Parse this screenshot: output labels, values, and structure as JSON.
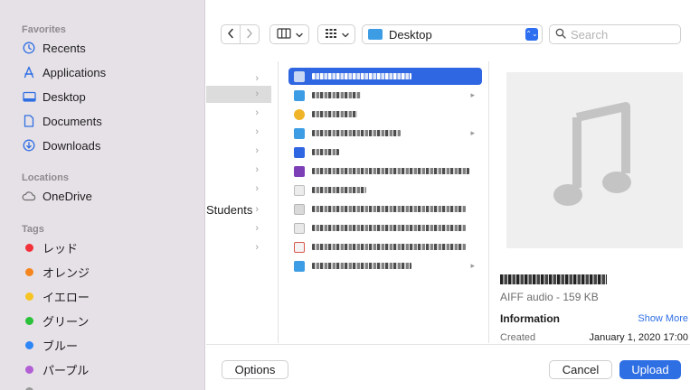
{
  "sidebar": {
    "favorites_title": "Favorites",
    "favorites": [
      {
        "label": "Recents",
        "icon": "clock-icon"
      },
      {
        "label": "Applications",
        "icon": "applications-icon"
      },
      {
        "label": "Desktop",
        "icon": "desktop-icon"
      },
      {
        "label": "Documents",
        "icon": "document-icon"
      },
      {
        "label": "Downloads",
        "icon": "download-icon"
      }
    ],
    "locations_title": "Locations",
    "locations": [
      {
        "label": "OneDrive",
        "icon": "cloud-icon"
      }
    ],
    "tags_title": "Tags",
    "tags": [
      {
        "label": "レッド",
        "color": "#f2313b"
      },
      {
        "label": "オレンジ",
        "color": "#f5861f"
      },
      {
        "label": "イエロー",
        "color": "#f6c423"
      },
      {
        "label": "グリーン",
        "color": "#2bc13a"
      },
      {
        "label": "ブルー",
        "color": "#2f86f6"
      },
      {
        "label": "パープル",
        "color": "#b25fd6"
      }
    ]
  },
  "toolbar": {
    "back_icon": "chevron-left-icon",
    "forward_icon": "chevron-right-icon",
    "view_icon": "columns-view-icon",
    "group_icon": "grid-icon",
    "location_label": "Desktop",
    "search_placeholder": "Search"
  },
  "browser": {
    "parent_column": {
      "visible_label": "Students"
    },
    "files": [
      {
        "icon_color": "#c9d6f4",
        "selected": true
      },
      {
        "icon_color": "#3d9de4",
        "selected": false
      },
      {
        "icon_color": "#f0b429",
        "selected": false
      },
      {
        "icon_color": "#3d9de4",
        "selected": false
      },
      {
        "icon_color": "#2f66e1",
        "selected": false
      },
      {
        "icon_color": "#7c3fb6",
        "selected": false
      },
      {
        "icon_color": "#ececec",
        "selected": false
      },
      {
        "icon_color": "#d9d9d9",
        "selected": false
      },
      {
        "icon_color": "#e9e9e9",
        "selected": false
      },
      {
        "icon_color": "#d8584a",
        "selected": false
      },
      {
        "icon_color": "#3d9de4",
        "selected": false
      }
    ]
  },
  "preview": {
    "kind_size": "AIFF audio - 159 KB",
    "info_heading": "Information",
    "show_more": "Show More",
    "created_label": "Created",
    "created_value": "January 1, 2020 17:00",
    "icon": "music-note-icon"
  },
  "footer": {
    "options_label": "Options",
    "cancel_label": "Cancel",
    "upload_label": "Upload"
  },
  "colors": {
    "accent": "#2f6fe4",
    "sidebar_bg": "#e6e1e6"
  }
}
